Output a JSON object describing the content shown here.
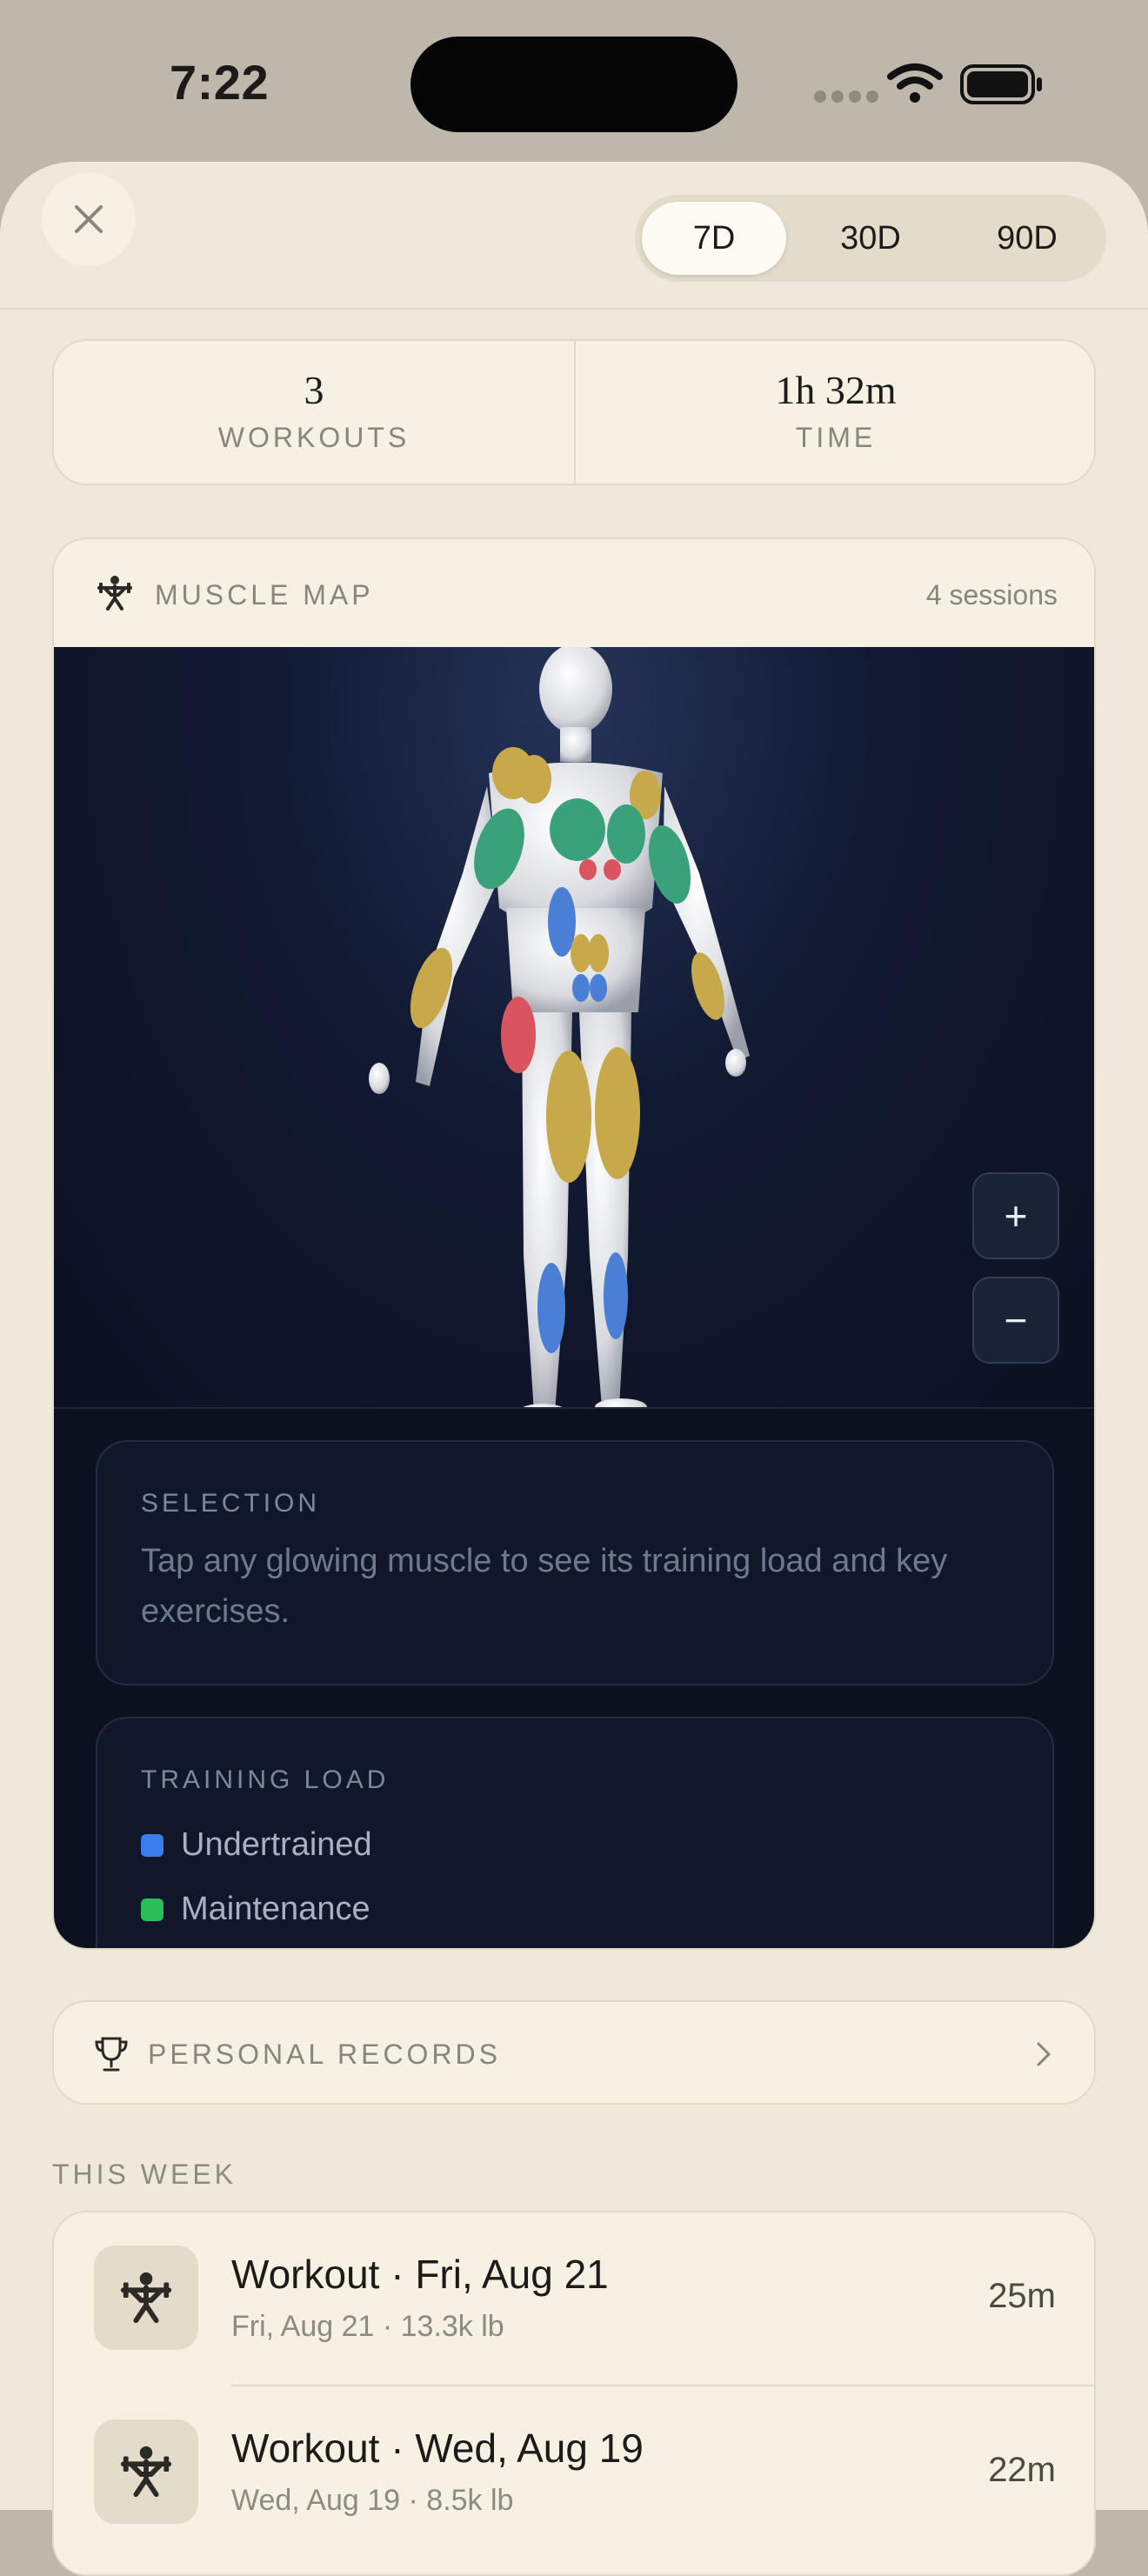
{
  "status": {
    "time": "7:22"
  },
  "range_tabs": [
    {
      "label": "7D",
      "active": true
    },
    {
      "label": "30D",
      "active": false
    },
    {
      "label": "90D",
      "active": false
    }
  ],
  "stats": {
    "workouts": {
      "value": "3",
      "label": "WORKOUTS"
    },
    "time": {
      "value": "1h 32m",
      "label": "TIME"
    }
  },
  "muscle_map": {
    "title": "MUSCLE MAP",
    "sessions": "4 sessions",
    "zoom_in": "+",
    "zoom_out": "−",
    "selection_label": "SELECTION",
    "selection_text": "Tap any glowing muscle to see its training load and key exercises.",
    "legend_label": "TRAINING LOAD",
    "legend": [
      {
        "label": "Undertrained",
        "color": "#3b7cf0"
      },
      {
        "label": "Maintenance",
        "color": "#2bbd5a"
      }
    ],
    "muscle_colors": {
      "undertrained": "#4b7fd6",
      "maintenance": "#3aa27a",
      "optimal": "#c7a84a",
      "overtrained": "#d9545e"
    }
  },
  "personal_records": {
    "title": "PERSONAL RECORDS"
  },
  "this_week": {
    "header": "THIS WEEK",
    "workouts": [
      {
        "title": "Workout · Fri, Aug 21",
        "subtitle": "Fri, Aug 21 · 13.3k lb",
        "duration": "25m"
      },
      {
        "title": "Workout · Wed, Aug 19",
        "subtitle": "Wed, Aug 19 · 8.5k lb",
        "duration": "22m"
      }
    ]
  }
}
